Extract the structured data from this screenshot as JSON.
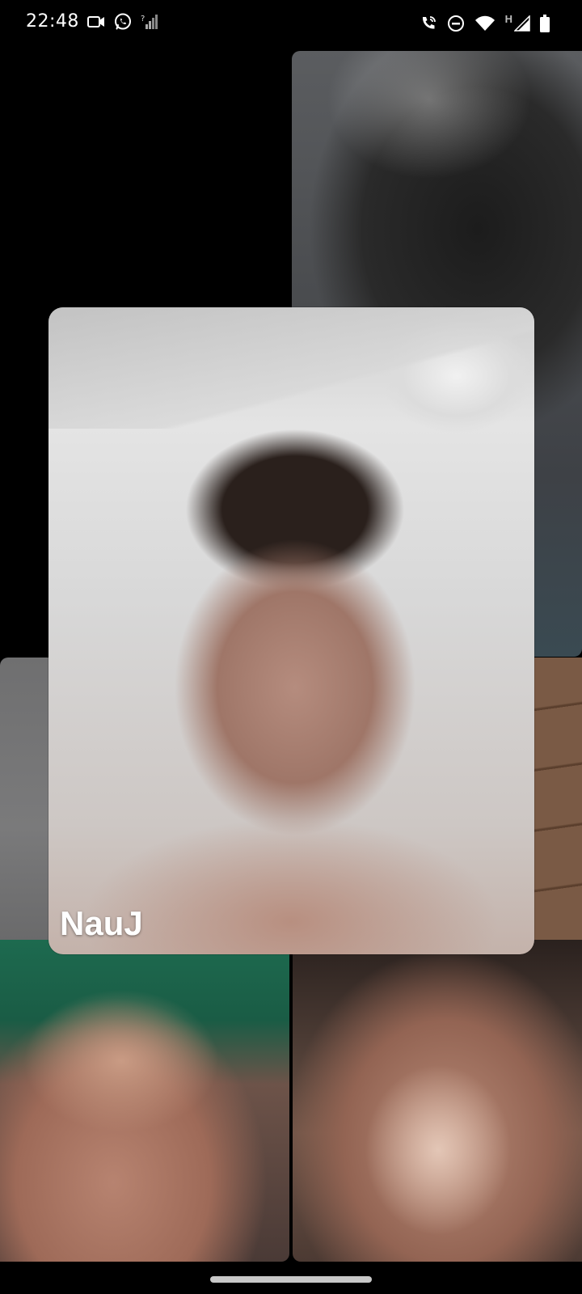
{
  "status_bar": {
    "time": "22:48",
    "network_type": "H",
    "left_icons": [
      "video-camera-icon",
      "whatsapp-icon",
      "unknown-signal-icon"
    ],
    "right_icons": [
      "wifi-call-icon",
      "do-not-disturb-icon",
      "wifi-icon",
      "cell-signal-icon",
      "battery-icon"
    ]
  },
  "call": {
    "active_participant": {
      "name": "NauJ"
    }
  }
}
